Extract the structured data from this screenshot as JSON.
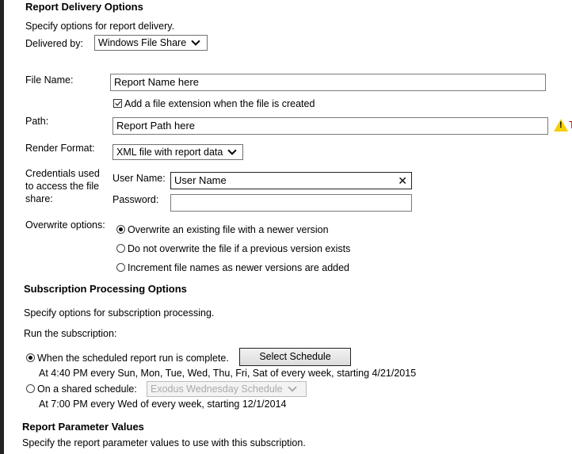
{
  "delivery": {
    "title": "Report Delivery Options",
    "desc": "Specify options for report delivery.",
    "delivered_by_label": "Delivered by:",
    "delivered_by_value": "Windows File Share",
    "file_name_label": "File Name:",
    "file_name_value": "Report Name here",
    "add_extension_label": "Add a file extension when the file is created",
    "add_extension_checked": true,
    "path_label": "Path:",
    "path_value": "Report Path here",
    "path_warning_text": "T",
    "render_format_label": "Render Format:",
    "render_format_value": "XML file with report data",
    "credentials_label_1": "Credentials used",
    "credentials_label_2": "to access the file",
    "credentials_label_3": "share:",
    "user_name_label": "User Name:",
    "user_name_value": "User Name",
    "password_label": "Password:",
    "password_value": "",
    "overwrite_label": "Overwrite options:",
    "overwrite_options": [
      {
        "label": "Overwrite an existing file with a newer version",
        "selected": true
      },
      {
        "label": "Do not overwrite the file if a previous version exists",
        "selected": false
      },
      {
        "label": "Increment file names as newer versions are added",
        "selected": false
      }
    ]
  },
  "processing": {
    "title": "Subscription Processing Options",
    "desc": "Specify options for subscription processing.",
    "run_label": "Run the subscription:",
    "option1_label": "When the scheduled report run is complete.",
    "option1_selected": true,
    "select_schedule_label": "Select Schedule",
    "option1_schedule": "At 4:40 PM every Sun, Mon, Tue, Wed, Thu, Fri, Sat of every week, starting 4/21/2015",
    "option2_label": "On a shared schedule:",
    "option2_selected": false,
    "shared_schedule_value": "Exodus Wednesday Schedule",
    "option2_schedule": "At 7:00 PM every Wed of every week, starting 12/1/2014"
  },
  "parameters": {
    "title": "Report Parameter Values",
    "desc": "Specify the report parameter values to use with this subscription."
  },
  "colors": {
    "warning": "#f4d000",
    "warning_text": "#c00000"
  }
}
